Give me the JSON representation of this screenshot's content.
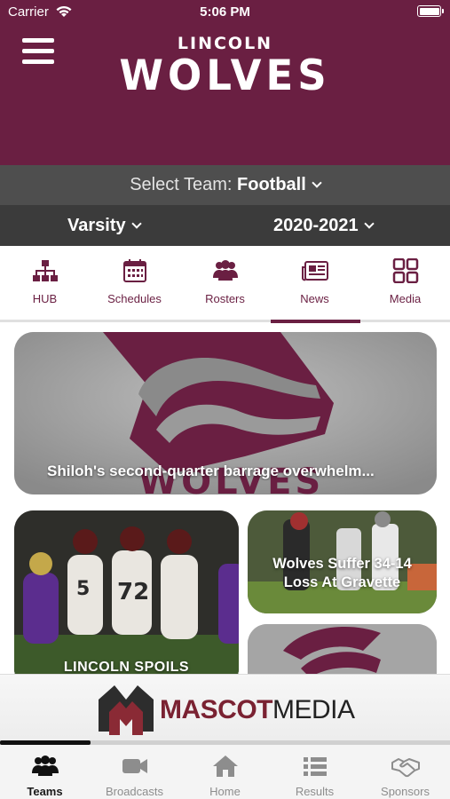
{
  "status_bar": {
    "carrier": "Carrier",
    "time": "5:06 PM"
  },
  "header": {
    "brand_top": "LINCOLN",
    "brand_main": "WOLVES",
    "bg_color": "#6a1f42"
  },
  "team_selector": {
    "label": "Select Team:",
    "value": "Football"
  },
  "level_selector": {
    "level": "Varsity",
    "season": "2020-2021"
  },
  "tabs": [
    {
      "label": "HUB",
      "icon": "hierarchy-icon"
    },
    {
      "label": "Schedules",
      "icon": "calendar-icon"
    },
    {
      "label": "Rosters",
      "icon": "group-icon"
    },
    {
      "label": "News",
      "icon": "newspaper-icon"
    },
    {
      "label": "Media",
      "icon": "grid-icon"
    }
  ],
  "active_tab": "News",
  "news": [
    {
      "headline": "Shiloh's second-quarter barrage overwhelm..."
    },
    {
      "headline": "Wolves Suffer 34-14 Loss At Gravette"
    },
    {
      "headline": "LINCOLN SPOILS"
    }
  ],
  "sponsor_ad": {
    "name_part1": "MASCOT",
    "name_part2": "MEDIA"
  },
  "bottom_nav": [
    {
      "label": "Teams",
      "icon": "group-icon"
    },
    {
      "label": "Broadcasts",
      "icon": "video-camera-icon"
    },
    {
      "label": "Home",
      "icon": "home-icon"
    },
    {
      "label": "Results",
      "icon": "list-icon"
    },
    {
      "label": "Sponsors",
      "icon": "handshake-icon"
    }
  ],
  "active_bottom_nav": "Teams"
}
